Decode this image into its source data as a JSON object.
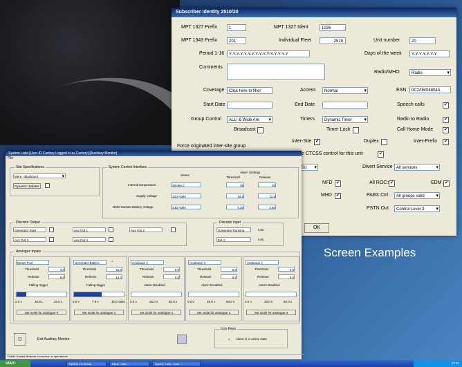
{
  "caption": "Screen Examples",
  "back": {
    "title": "Subscriber Identity 2510/20",
    "mpt1327_prefix_label": "MPT 1327 Prefix",
    "mpt1327_prefix": "1",
    "mpt1327_ident_label": "MPT 1327 Ident",
    "mpt1327_ident": "1026",
    "mpt1343_prefix_label": "MPT 1343 Prefix",
    "mpt1343_prefix": "201",
    "indiv_fleet_label": "Individual Fleet",
    "indiv_fleet": "2510",
    "unit_number_label": "Unit number",
    "unit_number": "20",
    "period_label": "Period 1-16",
    "period": "Y-Y-Y-Y-Y-Y-Y-Y-Y-Y-Y-Y-Y-Y-Y-Y",
    "days_label": "Days of the week",
    "days": "Y-Y-Y-Y-Y-Y-Y",
    "comments_label": "Comments",
    "radio_label": "Radio/MHO",
    "radio": "Radio",
    "coverage_label": "Coverage",
    "coverage": "Click here to filter",
    "access_label": "Access",
    "access": "Normal",
    "esn_label": "ESN",
    "esn": "0C2/06/048044",
    "start_date_label": "Start Date",
    "end_date_label": "End Date",
    "speech_label": "Speech calls",
    "group_label": "Group Control",
    "group": "ALL! & Wide Are",
    "timers_label": "Timers",
    "timers": "Dynamic Timer",
    "r2r_label": "Radio to Radio",
    "broadcast_label": "Broadcast",
    "timerlock_label": "Timer Lock",
    "callhome_label": "Call Home Mode",
    "force_label": "Force originated inter-site group",
    "intersite_label": "Inter-Site",
    "duplex_label": "Duplex",
    "interprefix_label": "Inter-Prefix",
    "ctcss_label": "Enable CTCSS control for this unit",
    "csu_value": "CSU",
    "divert_label": "Divert Service",
    "divert": "All services",
    "nfd_label": "NFD",
    "allroc_label": "All ROC's",
    "edm_label": "EDM",
    "mhd_label": "MHD",
    "pabx_label": "PABX Ctrl",
    "pabx": "All groups valid",
    "pstn_label": "PSTN Out",
    "pstn": "Control Level 3",
    "ok_label": "OK",
    "check_mark": "✔"
  },
  "front": {
    "title": "System Labs  [User ID Factory Logged in as Factory]  [Auxiliary Monitor]",
    "menu": "File",
    "site_spec_title": "Site Specifications",
    "site_value": "Mere - Blackpool",
    "dyn_updates_label": "Dynamic Updates",
    "sci_title": "System Control Interface",
    "status_label": "Status",
    "alarm_settings_label": "Alarm Settings",
    "threshold_label": "Threshold",
    "release_label": "Release",
    "rows": [
      {
        "label": "Internal temperature",
        "status": "29 deg C",
        "threshold": "35",
        "release": "30"
      },
      {
        "label": "Supply Voltage",
        "status": "13.5 Volts",
        "threshold": "10.5",
        "release": "11.6"
      },
      {
        "label": "DMM Module Battery Voltage",
        "status": "3.62 Volts",
        "threshold": "3.20",
        "release": "3.50"
      }
    ],
    "discrete_output_title": "Discrete Output",
    "outputs": [
      "Generator Start",
      "Aux Out 1",
      "Aux Out 2",
      "Aux Out 3",
      "Aux Out 4"
    ],
    "discrete_input_title": "Discrete Input",
    "inputs": [
      {
        "name": "Generator Running",
        "state": "Low"
      },
      {
        "name": "Ext 1",
        "state": "Low"
      }
    ],
    "analogue_title": "Analogue Inputs",
    "analogues": [
      {
        "name": "Diesel Fuel",
        "threshold": "4.0",
        "release": "5.0",
        "state": "Falling trigger",
        "fill": 0.2,
        "scale": [
          "0.0 v",
          "16.9 L",
          "25.0 L"
        ],
        "button": "Set scale for analogue 0"
      },
      {
        "name": "Generator Battery",
        "threshold": "11.0",
        "release": "12.0",
        "state": "Falling trigger",
        "fill": 0.55,
        "scale": [
          "0.0 v",
          "7.6 v",
          "12.0 Volts"
        ],
        "button": "Set scale for analogue 1"
      },
      {
        "name": "Analogue 2",
        "threshold": "0.0",
        "release": "0.0",
        "state": "Alarm Disabled",
        "fill": 0,
        "scale": [
          "0.0 v",
          "25.0 v",
          "50.0 v"
        ],
        "button": "Set scale for analogue 2"
      },
      {
        "name": "Analogue 3",
        "threshold": "0.0",
        "release": "0.0",
        "state": "Alarm Disabled",
        "fill": 0,
        "scale": [
          "0.0 v",
          "25.0 v",
          "50.0 v"
        ],
        "button": "Set scale for analogue 3"
      },
      {
        "name": "Analogue 4",
        "threshold": "0.0",
        "release": "0.0",
        "state": "Alarm Disabled",
        "fill": 0,
        "scale": [
          "0.0 v",
          "25.0 v",
          "50.0 v"
        ],
        "button": "Set scale for analogue 4"
      }
    ],
    "exit_label": "Exit Auxiliary Monitor",
    "icon_keys_title": "Icon Keys",
    "alarm_key_label": "Alarm is in active state",
    "status_bar": "Fiddle Trusted Network connection is operational"
  },
  "taskbar": {
    "start": "start",
    "items": [
      "System 1G Media",
      "Inbox - Micr...",
      "System Labs - User ..."
    ],
    "clock": "17:21"
  }
}
